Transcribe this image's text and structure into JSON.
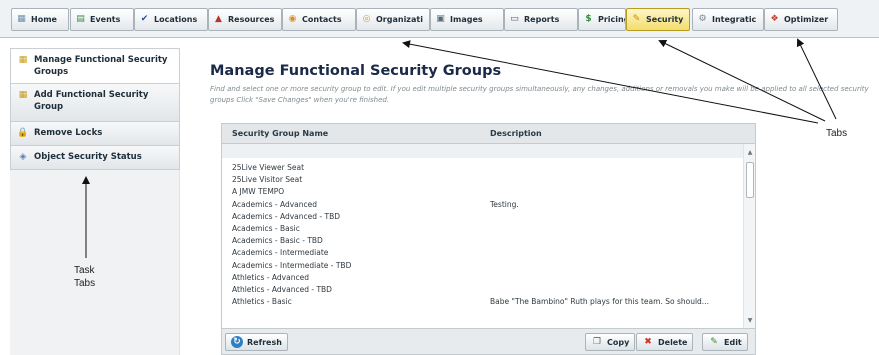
{
  "top_tabs": [
    {
      "label": "Home",
      "icon": "home-icon",
      "glyph": "▦",
      "color": "#6a8fb0"
    },
    {
      "label": "Events",
      "icon": "events-icon",
      "glyph": "▤",
      "color": "#3f8c4d"
    },
    {
      "label": "Locations",
      "icon": "locations-icon",
      "glyph": "✔",
      "color": "#2d4fa0"
    },
    {
      "label": "Resources",
      "icon": "resources-icon",
      "glyph": "▲",
      "color": "#b3372f"
    },
    {
      "label": "Contacts",
      "icon": "contacts-icon",
      "glyph": "◉",
      "color": "#d98a2b"
    },
    {
      "label": "Organizati",
      "icon": "organizations-icon",
      "glyph": "◎",
      "color": "#d59b2a"
    },
    {
      "label": "Images",
      "icon": "images-icon",
      "glyph": "▣",
      "color": "#5a6a78"
    },
    {
      "label": "Reports",
      "icon": "reports-icon",
      "glyph": "▭",
      "color": "#4a5560"
    },
    {
      "label": "Pricing",
      "icon": "pricing-icon",
      "glyph": "$",
      "color": "#2f8a3a"
    },
    {
      "label": "Security",
      "icon": "security-icon",
      "glyph": "✎",
      "color": "#c48a10"
    },
    {
      "label": "Integratic",
      "icon": "integration-icon",
      "glyph": "⚙",
      "color": "#7a8590"
    },
    {
      "label": "Optimizer",
      "icon": "optimizer-icon",
      "glyph": "❖",
      "color": "#c0392b"
    }
  ],
  "active_tab": "Security",
  "task_tabs": [
    {
      "label": "Manage Functional Security Groups",
      "icon": "manage-groups-icon",
      "glyph": "▦",
      "color": "#c99a1a"
    },
    {
      "label": "Add Functional Security Group",
      "icon": "add-group-icon",
      "glyph": "▦",
      "color": "#c99a1a"
    },
    {
      "label": "Remove Locks",
      "icon": "lock-icon",
      "glyph": "🔒",
      "color": "#d1a21c"
    },
    {
      "label": "Object Security Status",
      "icon": "shield-icon",
      "glyph": "◈",
      "color": "#5a83b5"
    }
  ],
  "main": {
    "title": "Manage Functional Security Groups",
    "instructions": "Find and select one or more security group to edit. If you edit multiple security groups simultaneously, any changes, additions or removals you make will be applied to all selected security groups Click \"Save Changes\" when you're finished."
  },
  "grid": {
    "columns": [
      "Security Group Name",
      "Description"
    ],
    "rows": [
      [
        "25Live Viewer Seat",
        ""
      ],
      [
        "25Live Visitor Seat",
        ""
      ],
      [
        "A JMW TEMPO",
        ""
      ],
      [
        "Academics - Advanced",
        "Testing."
      ],
      [
        "Academics - Advanced - TBD",
        ""
      ],
      [
        "Academics - Basic",
        ""
      ],
      [
        "Academics - Basic - TBD",
        ""
      ],
      [
        "Academics - Intermediate",
        ""
      ],
      [
        "Academics - Intermediate - TBD",
        ""
      ],
      [
        "Athletics - Advanced",
        ""
      ],
      [
        "Athletics - Advanced - TBD",
        ""
      ],
      [
        "Athletics - Basic",
        "Babe \"The Bambino\" Ruth plays for this team. So should..."
      ]
    ],
    "buttons": {
      "refresh": "Refresh",
      "copy": "Copy",
      "delete": "Delete",
      "edit": "Edit"
    }
  },
  "annotations": {
    "tabs_label": "Tabs",
    "task_tabs_label_line1": "Task",
    "task_tabs_label_line2": "Tabs"
  }
}
